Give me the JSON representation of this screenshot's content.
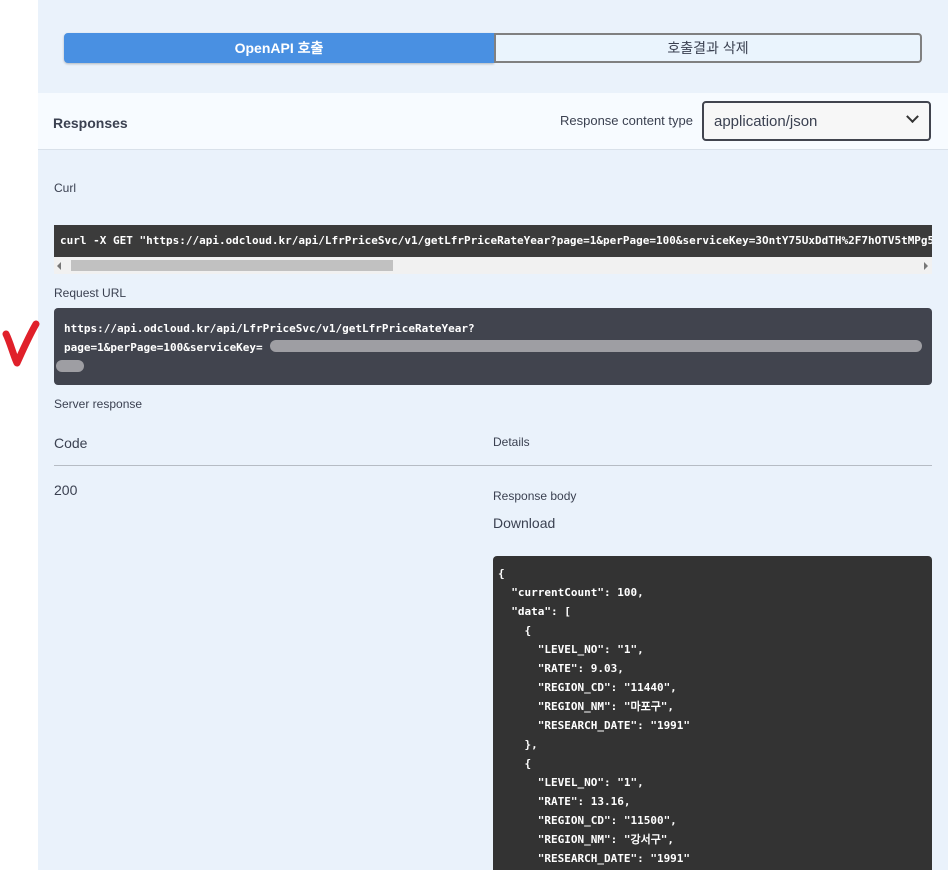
{
  "actions": {
    "execute_label": "OpenAPI 호출",
    "clear_label": "호출결과 삭제"
  },
  "responses": {
    "title": "Responses",
    "content_type_label": "Response content type",
    "content_type_value": "application/json"
  },
  "curl": {
    "label": "Curl",
    "command": "curl -X GET \"https://api.odcloud.kr/api/LfrPriceSvc/v1/getLfrPriceRateYear?page=1&perPage=100&serviceKey=3OntY75UxDdTH%2F7hOTV5tMPg5"
  },
  "request_url": {
    "label": "Request URL",
    "line1": "https://api.odcloud.kr/api/LfrPriceSvc/v1/getLfrPriceRateYear?",
    "line2": "page=1&perPage=100&serviceKey="
  },
  "server_response": {
    "label": "Server response",
    "code_header": "Code",
    "details_header": "Details",
    "status_code": "200",
    "body_label": "Response body",
    "download_label": "Download",
    "body": "{\n  \"currentCount\": 100,\n  \"data\": [\n    {\n      \"LEVEL_NO\": \"1\",\n      \"RATE\": 9.03,\n      \"REGION_CD\": \"11440\",\n      \"REGION_NM\": \"마포구\",\n      \"RESEARCH_DATE\": \"1991\"\n    },\n    {\n      \"LEVEL_NO\": \"1\",\n      \"RATE\": 13.16,\n      \"REGION_CD\": \"11500\",\n      \"REGION_NM\": \"강서구\",\n      \"RESEARCH_DATE\": \"1991\""
  },
  "annotation": {
    "mark_color": "#e0202a"
  }
}
